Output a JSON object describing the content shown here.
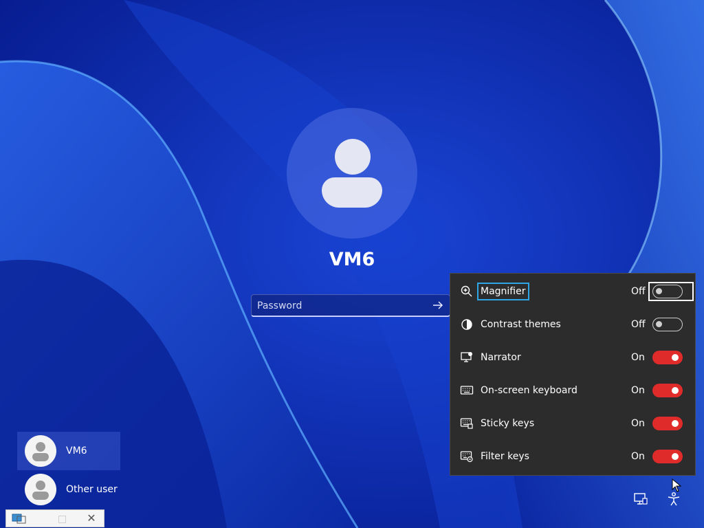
{
  "lock_screen": {
    "username": "VM6",
    "password_placeholder": "Password"
  },
  "users": [
    {
      "name": "VM6",
      "selected": true
    },
    {
      "name": "Other user",
      "selected": false
    }
  ],
  "accessibility_panel": {
    "items": [
      {
        "label": "Magnifier",
        "state": "Off",
        "on": false,
        "icon": "magnifier-icon"
      },
      {
        "label": "Contrast themes",
        "state": "Off",
        "on": false,
        "icon": "contrast-icon"
      },
      {
        "label": "Narrator",
        "state": "On",
        "on": true,
        "icon": "narrator-icon"
      },
      {
        "label": "On-screen keyboard",
        "state": "On",
        "on": true,
        "icon": "keyboard-icon"
      },
      {
        "label": "Sticky keys",
        "state": "On",
        "on": true,
        "icon": "sticky-keys-icon"
      },
      {
        "label": "Filter keys",
        "state": "On",
        "on": true,
        "icon": "filter-keys-icon"
      }
    ]
  },
  "colors": {
    "background": "#0c2bb0",
    "toggle_on": "#e02b2b",
    "focus_ring": "#2fa6e8"
  }
}
